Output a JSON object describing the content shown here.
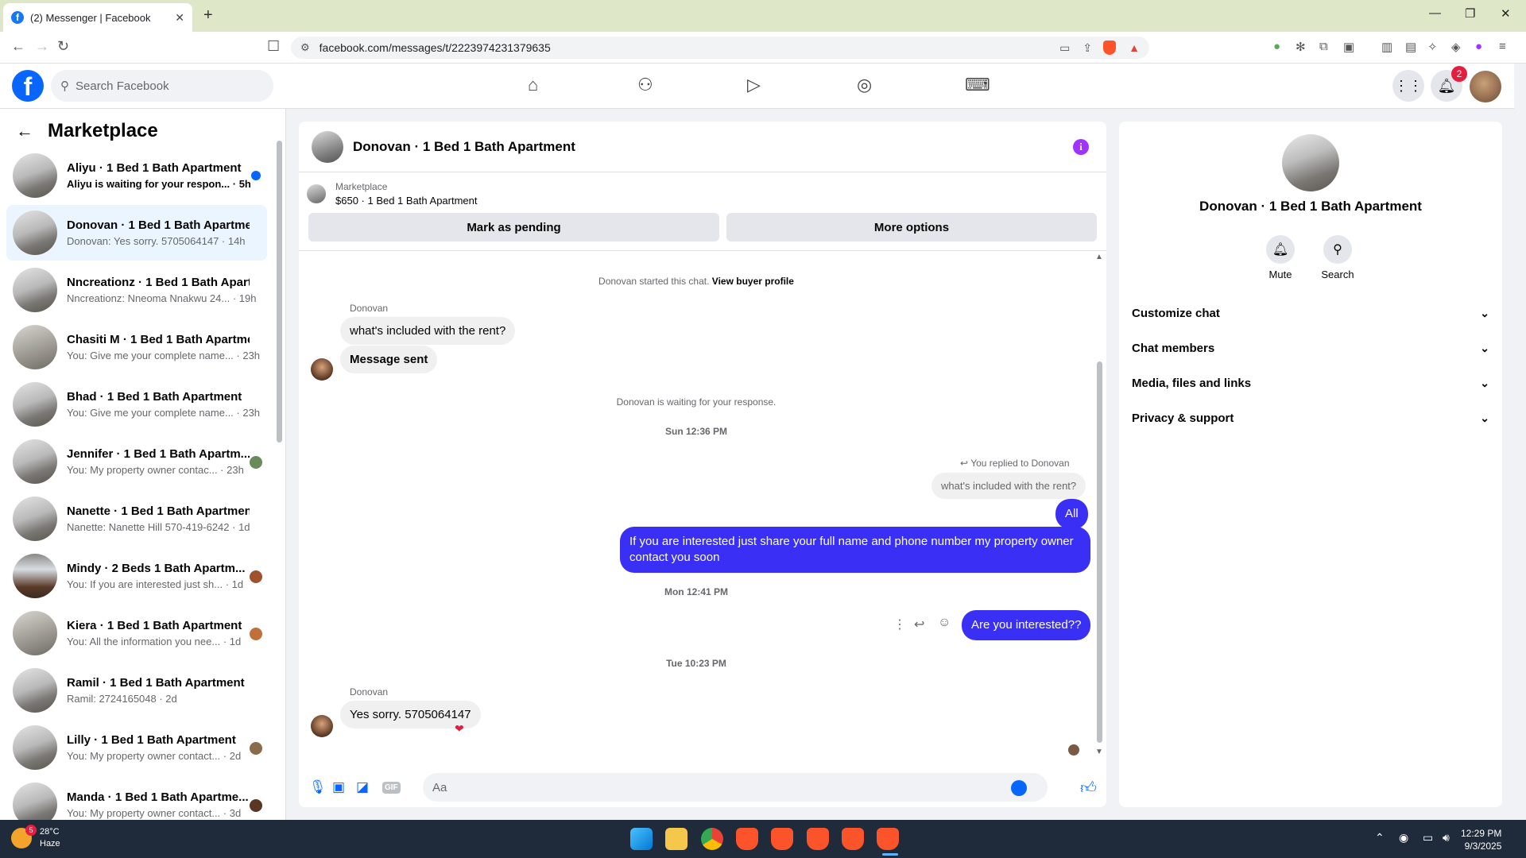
{
  "browser": {
    "tab_title": "(2) Messenger | Facebook",
    "url": "facebook.com/messages/t/2223974231379635"
  },
  "facebook": {
    "search_placeholder": "Search Facebook",
    "notification_count": "2",
    "brand_color": "#0866ff"
  },
  "sidebar": {
    "title": "Marketplace",
    "conversations": [
      {
        "name": "Aliyu · 1 Bed 1 Bath Apartment",
        "snippet": "Aliyu is waiting for your respon... · 5h",
        "unread": true
      },
      {
        "name": "Donovan · 1 Bed 1 Bath Apartment",
        "snippet": "Donovan: Yes sorry. 5705064147 · 14h",
        "active": true
      },
      {
        "name": "Nncreationz · 1 Bed 1 Bath Apart...",
        "snippet": "Nncreationz: Nneoma Nnakwu 24... · 19h"
      },
      {
        "name": "Chasiti M · 1 Bed 1 Bath Apartme...",
        "snippet": "You: Give me your complete name... · 23h"
      },
      {
        "name": "Bhad · 1 Bed 1 Bath Apartment",
        "snippet": "You: Give me your complete name... · 23h"
      },
      {
        "name": "Jennifer · 1 Bed 1 Bath Apartm...",
        "snippet": "You: My property owner contac... · 23h"
      },
      {
        "name": "Nanette · 1 Bed 1 Bath Apartment",
        "snippet": "Nanette: Nanette Hill 570-419-6242 · 1d"
      },
      {
        "name": "Mindy · 2 Beds 1 Bath Apartm...",
        "snippet": "You: If you are interested just sh... · 1d"
      },
      {
        "name": "Kiera · 1 Bed 1 Bath Apartment",
        "snippet": "You: All the information you nee... · 1d"
      },
      {
        "name": "Ramil · 1 Bed 1 Bath Apartment",
        "snippet": "Ramil: 2724165048 · 2d"
      },
      {
        "name": "Lilly · 1 Bed 1 Bath Apartment",
        "snippet": "You: My property owner contact... · 2d"
      },
      {
        "name": "Manda · 1 Bed 1 Bath Apartme...",
        "snippet": "You: My property owner contact... · 3d"
      }
    ]
  },
  "chat": {
    "title": "Donovan · 1 Bed 1 Bath Apartment",
    "listing_source": "Marketplace",
    "listing_price": "$650 · 1 Bed 1 Bath Apartment",
    "mark_pending": "Mark as pending",
    "more_options": "More options",
    "started_text": "Donovan started this chat.",
    "view_buyer_profile": "View buyer profile",
    "sender_name": "Donovan",
    "msg_question": "what's included with the rent?",
    "msg_sent": "Message sent",
    "waiting_text": "Donovan is waiting for your response.",
    "time_1": "Sun 12:36 PM",
    "replied_to": "You replied to Donovan",
    "reply_quote": "what's included with the rent?",
    "msg_all": "All",
    "msg_interested": "If you are interested just share your full name and phone number my property owner contact you soon",
    "time_2": "Mon 12:41 PM",
    "msg_are_you": "Are you interested??",
    "time_3": "Tue 10:23 PM",
    "msg_yes_sorry": "Yes sorry. 5705064147",
    "composer_placeholder": "Aa",
    "gif_label": "GIF",
    "outgoing_color": "#3a30f5"
  },
  "right_panel": {
    "name": "Donovan · 1 Bed 1 Bath Apartment",
    "mute": "Mute",
    "search": "Search",
    "items": [
      "Customize chat",
      "Chat members",
      "Media, files and links",
      "Privacy & support"
    ]
  },
  "taskbar": {
    "temperature": "28°C",
    "weather": "Haze",
    "weather_badge": "5",
    "time": "12:29 PM",
    "date": "9/3/2025"
  }
}
